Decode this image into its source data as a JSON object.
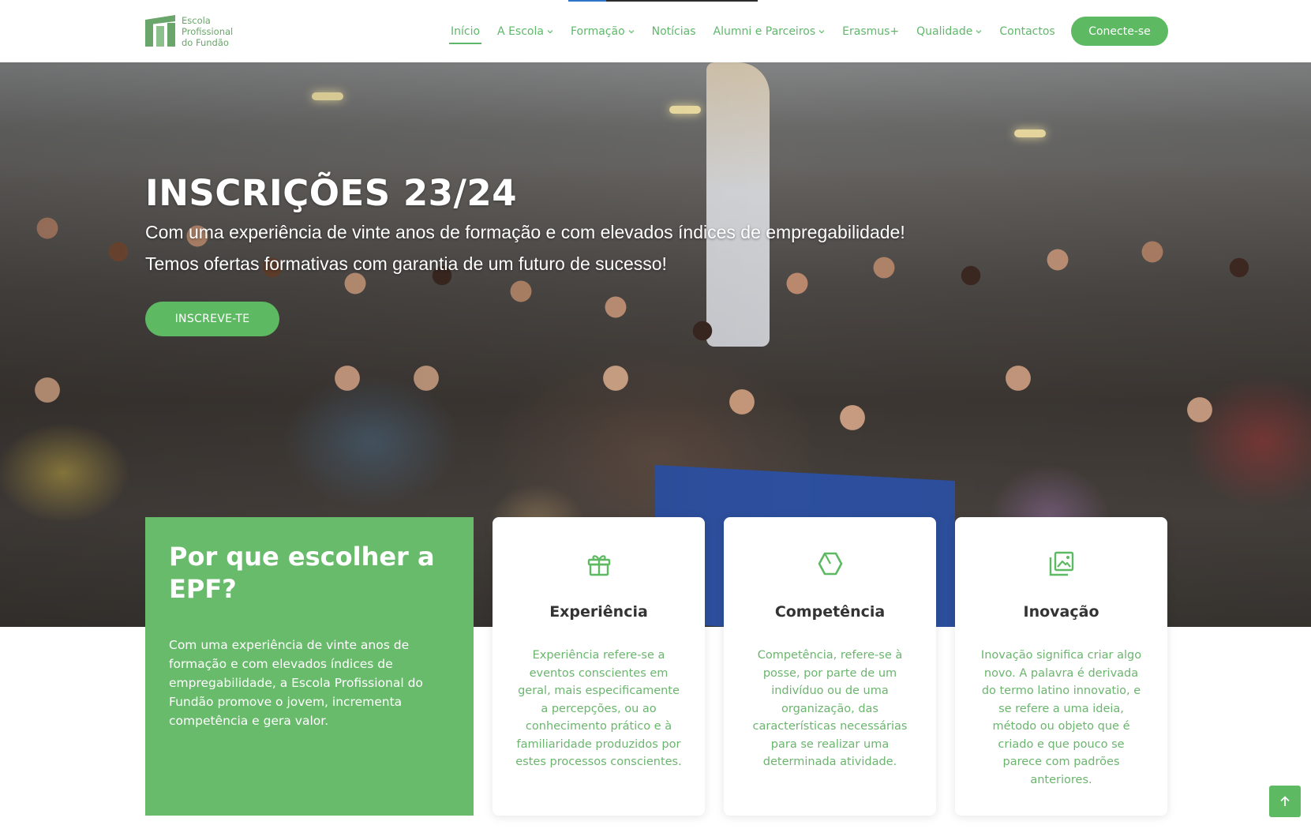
{
  "logo": {
    "line1": "Escola",
    "line2": "Profissional",
    "line3": "do Fundão"
  },
  "nav": {
    "items": [
      {
        "label": "Início",
        "active": true,
        "dropdown": false
      },
      {
        "label": "A Escola",
        "active": false,
        "dropdown": true
      },
      {
        "label": "Formação",
        "active": false,
        "dropdown": true
      },
      {
        "label": "Notícias",
        "active": false,
        "dropdown": false
      },
      {
        "label": "Alumni e Parceiros",
        "active": false,
        "dropdown": true
      },
      {
        "label": "Erasmus+",
        "active": false,
        "dropdown": false
      },
      {
        "label": "Qualidade",
        "active": false,
        "dropdown": true
      },
      {
        "label": "Contactos",
        "active": false,
        "dropdown": false
      }
    ],
    "connect_label": "Conecte-se"
  },
  "hero": {
    "title": "INSCRIÇÕES 23/24",
    "subtitle_line1": "Com uma experiência de vinte anos de formação e com elevados índices de empregabilidade!",
    "subtitle_line2": "Temos ofertas formativas com garantia de um futuro de sucesso!",
    "cta_label": "INSCREVE-TE"
  },
  "why": {
    "title": "Por que escolher a EPF?",
    "text": "Com uma experiência de vinte anos de formação e com elevados índices de empregabilidade, a Escola Profissional do Fundão promove o jovem, incrementa competência e gera valor."
  },
  "features": [
    {
      "icon": "gift-icon",
      "title": "Experiência",
      "text": "Experiência refere-se a eventos conscientes em geral, mais especificamente a percepções, ou ao conhecimento prático e à familiaridade produzidos por estes processos conscientes."
    },
    {
      "icon": "hexagon-icon",
      "title": "Competência",
      "text": "Competência, refere-se à posse, por parte de um indivíduo ou de uma organização, das características necessárias para se realizar uma determinada atividade."
    },
    {
      "icon": "images-icon",
      "title": "Inovação",
      "text": "Inovação significa criar algo novo. A palavra é derivada do termo latino innovatio, e se refere a uma ideia, método ou objeto que é criado e que pouco se parece com padrões anteriores."
    }
  ],
  "colors": {
    "brand_green": "#5db962",
    "why_bg": "#69bb6c",
    "text_green": "#6bb56e"
  },
  "scroll_top_icon": "arrow-up-icon"
}
